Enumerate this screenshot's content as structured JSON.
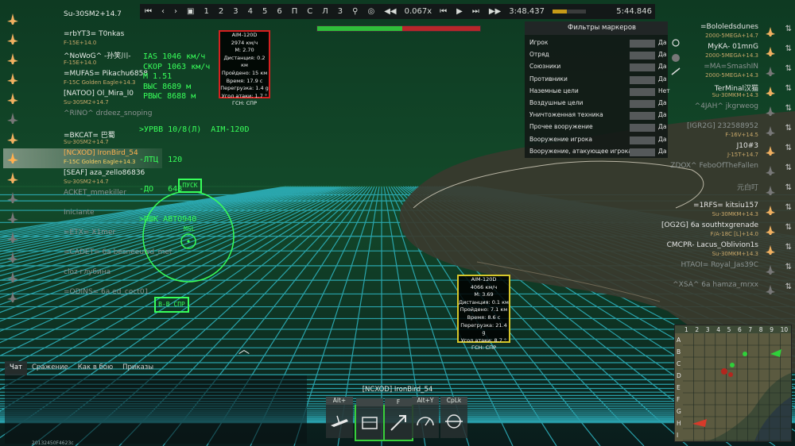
{
  "topbar": {
    "numbers": [
      "1",
      "2",
      "3",
      "4",
      "5",
      "6",
      "П",
      "С",
      "Л",
      "3"
    ],
    "speed": "0.067x",
    "time_current": "3:48.437",
    "time_total": "5:44.846",
    "progress": 0.42,
    "health_green": 0.52
  },
  "left_list": [
    {
      "name": "Su-30SM2+14.7",
      "vehicle": "",
      "dead": false
    },
    {
      "name": "=rbYT3= T0nkas",
      "vehicle": "F-15E+14.0",
      "dead": false
    },
    {
      "name": "^NoWoG^ -孙笑川-",
      "vehicle": "F-15E+14.0",
      "dead": false
    },
    {
      "name": "=MUFAS= Pikachu6858",
      "vehicle": "F-15C Golden Eagle+14.3",
      "dead": false
    },
    {
      "name": "[NATOO] Ol_Mira_l0",
      "vehicle": "Su-30SM2+14.7",
      "dead": false
    },
    {
      "name": "^RINO^ drdeez_snoping",
      "vehicle": "",
      "dead": true
    },
    {
      "name": "=BKCAT= 巴蜀",
      "vehicle": "Su-30SM2+14.7",
      "dead": false
    },
    {
      "name": "[NCXOD] IronBird_54",
      "vehicle": "F-15C Golden Eagle+14.3",
      "dead": false,
      "selected": true
    },
    {
      "name": "[SEAF] aza_zello86836",
      "vehicle": "Su-30SM2+14.7",
      "dead": false
    },
    {
      "name": "ACKET_mmekiller",
      "vehicle": "",
      "dead": true
    },
    {
      "name": "Iniciante",
      "vehicle": "",
      "dead": true
    },
    {
      "name": "=ETX= X1mer",
      "vehicle": "",
      "dead": true
    },
    {
      "name": "=CADET= 6a besneeuwd_met",
      "vehicle": "",
      "dead": true
    },
    {
      "name": "cloz глубина",
      "vehicle": "",
      "dead": true
    },
    {
      "name": "=ODINS= 6a ed_coct01",
      "vehicle": "",
      "dead": true
    }
  ],
  "hud": {
    "ias": "IAS  1046 км/ч",
    "skor": "СКОР 1063 км/ч",
    "m": "М    1.51",
    "vys": "ВЫС  8689 м",
    "rvys": "РВЫС 8688 м",
    "urvv": ">УРВВ 10/8(Л)  AIM-120D",
    "ltc": "-ЛТЦ  120",
    "do": "-ДО   648",
    "pshk": ">ПШК АВТО940",
    "pusk": "ПУСК",
    "msl": "MSL",
    "vspr": "В-В СПР"
  },
  "missile1": {
    "name": "AIM-120D",
    "speed": "2974 км/ч",
    "mach": "М: 2.70",
    "dist": "Дистанция: 0.2 км",
    "passed": "Пройдено: 15 км",
    "time": "Время: 17.9 с",
    "g": "Перегрузка: 1.4 g",
    "angle": "Угол атаки: 1.7 °",
    "seeker": "ГСН: СПР"
  },
  "missile2": {
    "name": "AIM-120D",
    "speed": "4066 км/ч",
    "mach": "М: 3.69",
    "dist": "Дистанция: 0.1 км",
    "passed": "Пройдено: 7.1 км",
    "time": "Время: 8.6 с",
    "g": "Перегрузка: 21.4 g",
    "angle": "Угол атаки: 8.7 °",
    "seeker": "ГСН: СПР"
  },
  "filters": {
    "title": "Фильтры маркеров",
    "rows": [
      {
        "label": "Игрок",
        "value": "Да"
      },
      {
        "label": "Отряд",
        "value": "Да"
      },
      {
        "label": "Союзники",
        "value": "Да"
      },
      {
        "label": "Противники",
        "value": "Да"
      },
      {
        "label": "Наземные цели",
        "value": "Нет"
      },
      {
        "label": "Воздушные цели",
        "value": "Да"
      },
      {
        "label": "Уничтоженная техника",
        "value": "Да"
      },
      {
        "label": "Прочее вооружение",
        "value": "Да"
      },
      {
        "label": "Вооружение игрока",
        "value": "Да"
      },
      {
        "label": "Вооружение, атакующее игрока",
        "value": "Да"
      }
    ]
  },
  "right_list": [
    {
      "name": "=Bololedsdunes",
      "vehicle": "2000-5MEGA+14.7",
      "dead": false
    },
    {
      "name": "MyKA- 01mnG",
      "vehicle": "2000-5MEGA+14.3",
      "dead": false
    },
    {
      "name": "=MA=SmashIN",
      "vehicle": "2000-5MEGA+14.3",
      "dead": true
    },
    {
      "name": "TerMinal汉猫",
      "vehicle": "Su-30MKM+14.3",
      "dead": false
    },
    {
      "name": "^4JAH^ jkgrweog",
      "vehicle": "",
      "dead": true
    },
    {
      "name": "[IGR2G] 232588952",
      "vehicle": "F-16V+14.5",
      "dead": true
    },
    {
      "name": "J10#3",
      "vehicle": "J-15T+14.7",
      "dead": false
    },
    {
      "name": "ZDOX^ FeboOfTheFallen",
      "vehicle": "",
      "dead": true
    },
    {
      "name": "元白叮",
      "vehicle": "",
      "dead": true
    },
    {
      "name": "=1RFS= kitsiu157",
      "vehicle": "Su-30MKM+14.3",
      "dead": false
    },
    {
      "name": "[OG2G] 6a southtxgrenade",
      "vehicle": "F/A-18C [L]+14.0",
      "dead": false
    },
    {
      "name": "CMCPR- Lacus_Oblivion1s",
      "vehicle": "Su-30MKM+14.3",
      "dead": false
    },
    {
      "name": "HTAOI= Royal_Jas39C",
      "vehicle": "",
      "dead": true
    },
    {
      "name": "^XSA^ 6a hamza_mrxx",
      "vehicle": "",
      "dead": true
    }
  ],
  "chat_tabs": [
    "Чат",
    "Сражение",
    "Как в бою",
    "Приказы"
  ],
  "viewer_name": "[NCXOD] IronBird_54",
  "controls": [
    {
      "key": "Alt+",
      "icon": "aircraft-view-icon"
    },
    {
      "key": "",
      "icon": "chest-icon"
    },
    {
      "key": "F",
      "icon": "fly-toward-icon"
    },
    {
      "key": "Alt+Y",
      "icon": "gauge-icon"
    },
    {
      "key": "CpLk",
      "icon": "cycle-camera-icon"
    }
  ],
  "minimap": {
    "cols": [
      "1",
      "2",
      "3",
      "4",
      "5",
      "6",
      "7",
      "8",
      "9",
      "10"
    ],
    "rows": [
      "A",
      "B",
      "C",
      "D",
      "E",
      "F",
      "G",
      "H",
      "I"
    ]
  },
  "footer_id": "20132450F4623c"
}
